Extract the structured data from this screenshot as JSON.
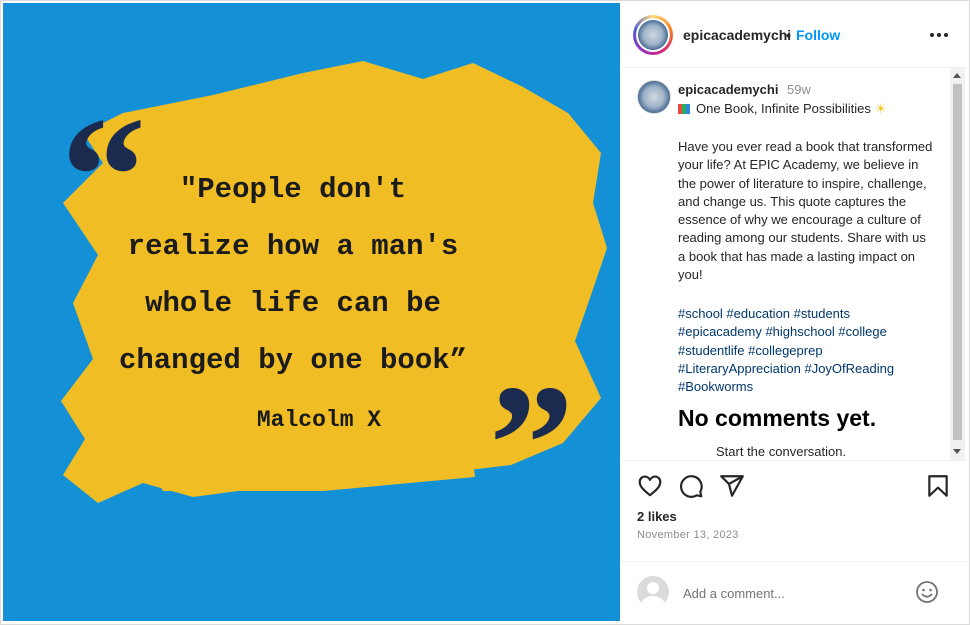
{
  "post": {
    "quote_lines": [
      "\"People don't",
      "realize how a man's",
      "whole life can be",
      "changed by one book”"
    ],
    "author": "Malcolm X"
  },
  "header": {
    "username": "epicacademychi",
    "separator": "•",
    "follow_label": "Follow",
    "more_icon": "more-horizontal-icon"
  },
  "caption": {
    "username": "epicacademychi",
    "time": "59w",
    "title": "One Book, Infinite Possibilities",
    "title_prefix_icon": "books-emoji",
    "title_suffix_icon": "sun-emoji",
    "sun_glyph": "☀",
    "body": "Have you ever read a book that transformed your life? At EPIC Academy, we believe in the power of literature to inspire, challenge, and change us. This quote captures the essence of why we encourage a culture of reading among our students. Share with us a book that has made a lasting impact on you!",
    "hashtag_lines": [
      "#school #education #students",
      "#epicacademy #highschool #college",
      "#studentlife #collegeprep",
      "#LiteraryAppreciation #JoyOfReading",
      "#Bookworms"
    ]
  },
  "comments": {
    "empty_title": "No comments yet.",
    "empty_subtitle": "Start the conversation."
  },
  "actions": {
    "like_icon": "heart-icon",
    "comment_icon": "comment-icon",
    "share_icon": "send-icon",
    "save_icon": "bookmark-icon"
  },
  "stats": {
    "likes": "2 likes",
    "date": "November 13, 2023"
  },
  "add_comment": {
    "placeholder": "Add a comment...",
    "emoji_icon": "emoji-icon"
  },
  "colors": {
    "image_background": "#1491d6",
    "brush_yellow": "#f0be24",
    "quote_marks": "#1b2b4f",
    "link_blue": "#0095f6",
    "hashtag_blue": "#00376b"
  }
}
